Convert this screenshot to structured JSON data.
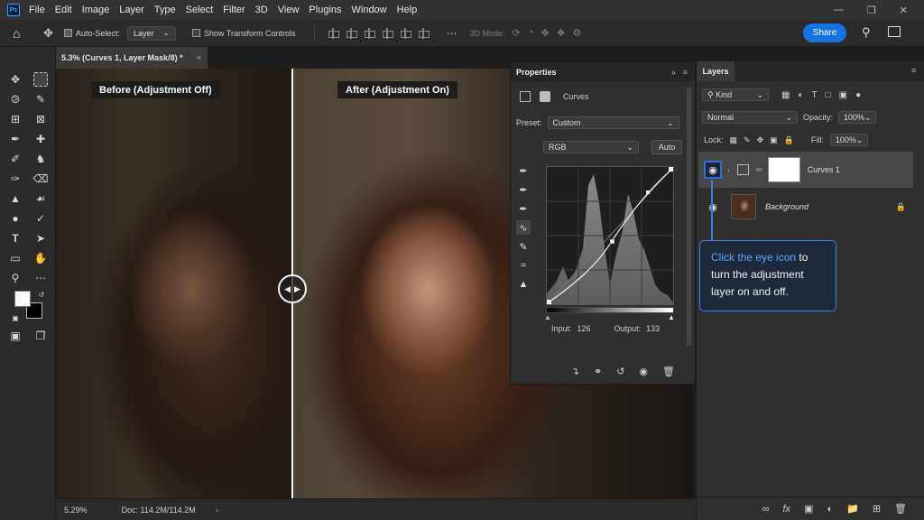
{
  "app": {
    "logo": "Ps",
    "menu": [
      "File",
      "Edit",
      "Image",
      "Layer",
      "Type",
      "Select",
      "Filter",
      "3D",
      "View",
      "Plugins",
      "Window",
      "Help"
    ]
  },
  "options": {
    "auto_select_label": "Auto-Select:",
    "auto_select_value": "Layer",
    "transform_label": "Show Transform Controls",
    "mode_3d_label": "3D Mode:",
    "share_label": "Share"
  },
  "document": {
    "tab_title": "5.3% (Curves 1, Layer Mask/8) *",
    "close_glyph": "×"
  },
  "canvas": {
    "before_label": "Before (Adjustment Off)",
    "after_label": "After (Adjustment On)"
  },
  "properties": {
    "title": "Properties",
    "adjustment_name": "Curves",
    "preset_label": "Preset:",
    "preset_value": "Custom",
    "channel_value": "RGB",
    "auto_label": "Auto",
    "input_label": "Input:",
    "input_value": "126",
    "output_label": "Output:",
    "output_value": "133"
  },
  "layers": {
    "title": "Layers",
    "filter_label": "Kind",
    "blend_mode": "Normal",
    "opacity_label": "Opacity:",
    "opacity_value": "100%",
    "lock_label": "Lock:",
    "fill_label": "Fill:",
    "fill_value": "100%",
    "items": [
      {
        "name": "Curves 1",
        "selected": true
      },
      {
        "name": "Background",
        "selected": false
      }
    ]
  },
  "callout": {
    "highlight": "Click the eye icon",
    "rest": " to turn the adjustment layer on and off."
  },
  "status": {
    "zoom": "5.29%",
    "doc": "Doc: 114.2M/114.2M"
  },
  "colors": {
    "accent": "#1473e6",
    "callout_border": "#3f7fe0"
  }
}
